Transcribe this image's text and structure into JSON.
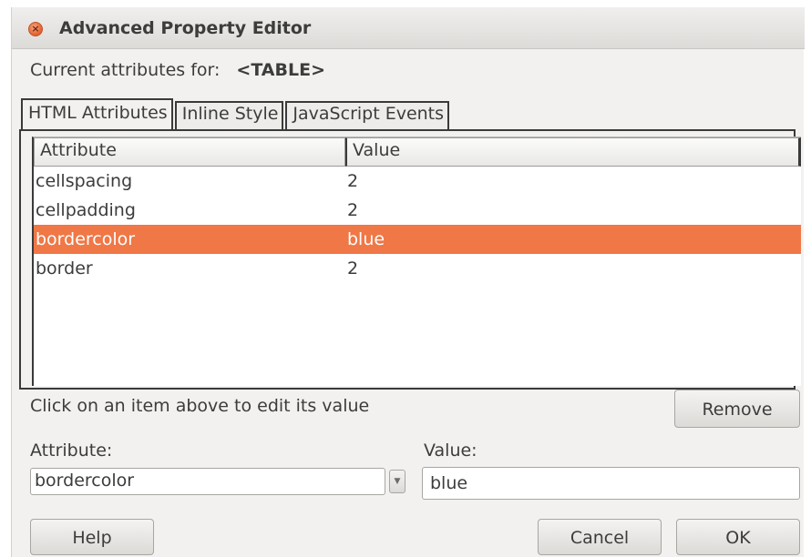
{
  "window": {
    "title": "Advanced Property Editor",
    "close_icon": "close-icon"
  },
  "header": {
    "current_label": "Current attributes for:",
    "current_tag": "<TABLE>"
  },
  "tabs": [
    {
      "label": "HTML Attributes",
      "active": true
    },
    {
      "label": "Inline Style",
      "active": false
    },
    {
      "label": "JavaScript Events",
      "active": false
    }
  ],
  "table": {
    "columns": [
      "Attribute",
      "Value"
    ],
    "rows": [
      {
        "attribute": "cellspacing",
        "value": "2"
      },
      {
        "attribute": "cellpadding",
        "value": "2"
      },
      {
        "attribute": "bordercolor",
        "value": "blue",
        "selected": true
      },
      {
        "attribute": "border",
        "value": "2"
      }
    ]
  },
  "hint": "Click on an item above to edit its value",
  "buttons": {
    "remove": "Remove",
    "help": "Help",
    "cancel": "Cancel",
    "ok": "OK"
  },
  "editor": {
    "attribute_label": "Attribute:",
    "value_label": "Value:",
    "attribute_value": "bordercolor",
    "value_value": "blue"
  },
  "colors": {
    "selection": "#f07746",
    "close_button": "#e2612b",
    "dialog_bg": "#f2f1f0"
  }
}
